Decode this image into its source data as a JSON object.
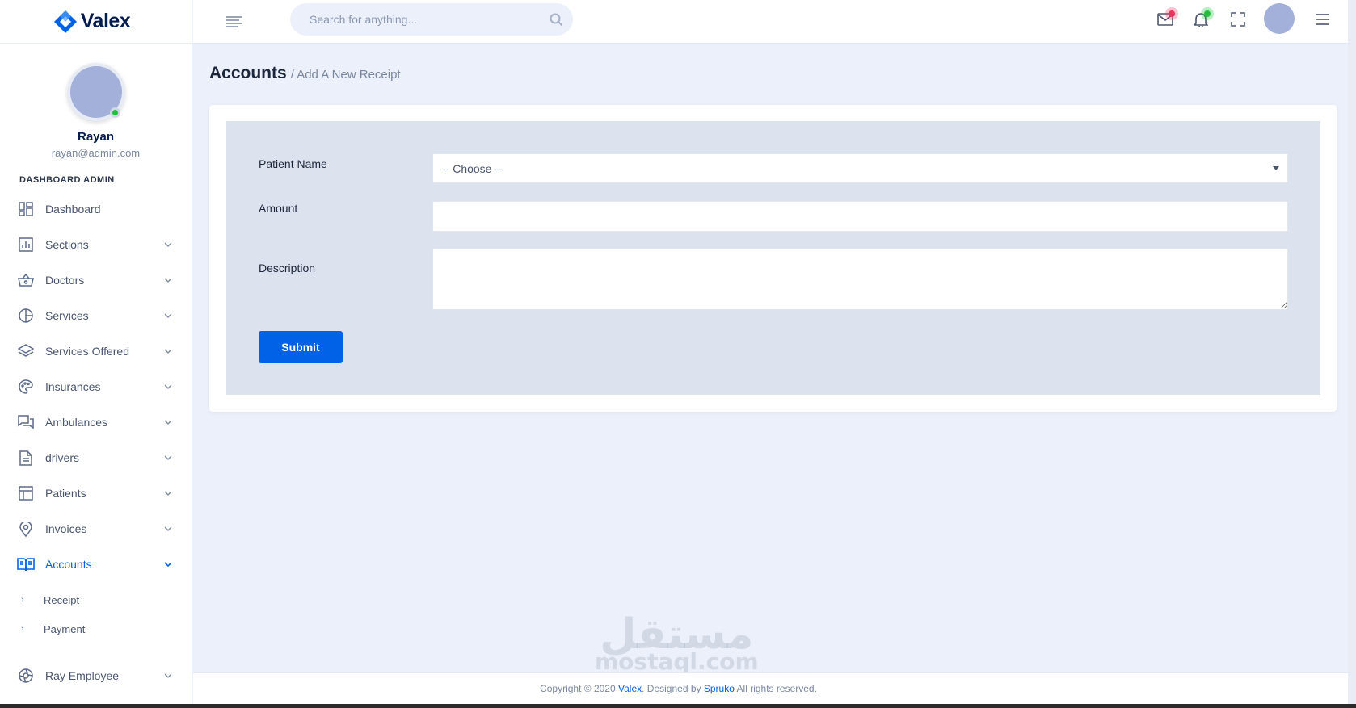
{
  "brand": {
    "name": "Valex",
    "primary_color": "#0162e8",
    "logo_icon": "diamond-logo-icon"
  },
  "sidebar": {
    "user": {
      "name": "Rayan",
      "email": "rayan@admin.com",
      "status": "online"
    },
    "category": "DASHBOARD ADMIN",
    "items": [
      {
        "label": "Dashboard",
        "icon": "dashboard-grid-icon",
        "expandable": false
      },
      {
        "label": "Sections",
        "icon": "bar-chart-icon",
        "expandable": true
      },
      {
        "label": "Doctors",
        "icon": "basket-icon",
        "expandable": true
      },
      {
        "label": "Services",
        "icon": "pie-chart-icon",
        "expandable": true
      },
      {
        "label": "Services Offered",
        "icon": "layers-icon",
        "expandable": true
      },
      {
        "label": "Insurances",
        "icon": "palette-icon",
        "expandable": true
      },
      {
        "label": "Ambulances",
        "icon": "chat-icon",
        "expandable": true
      },
      {
        "label": "drivers",
        "icon": "document-icon",
        "expandable": true
      },
      {
        "label": "Patients",
        "icon": "table-icon",
        "expandable": true
      },
      {
        "label": "Invoices",
        "icon": "map-pin-icon",
        "expandable": true
      },
      {
        "label": "Accounts",
        "icon": "open-book-icon",
        "expandable": true,
        "active": true
      }
    ],
    "accounts_submenu": [
      {
        "label": "Receipt"
      },
      {
        "label": "Payment"
      }
    ],
    "last_item": {
      "label": "Ray Employee",
      "icon": "aperture-icon",
      "expandable": true
    }
  },
  "header": {
    "search_placeholder": "Search for anything...",
    "icons": [
      "menu-lines-icon",
      "search-icon",
      "mail-icon",
      "bell-icon",
      "fullscreen-icon",
      "avatar",
      "hamburger-icon"
    ]
  },
  "page": {
    "title": "Accounts",
    "subtitle": "/ Add A New Receipt"
  },
  "form": {
    "patient_label": "Patient Name",
    "patient_selected": "-- Choose --",
    "amount_label": "Amount",
    "amount_value": "",
    "description_label": "Description",
    "description_value": "",
    "submit_label": "Submit"
  },
  "watermark": {
    "arabic": "مستقل",
    "latin": "mostaql.com"
  },
  "footer": {
    "prefix": "Copyright © 2020 ",
    "brand_link": "Valex",
    "middle": ". Designed by ",
    "designer_link": "Spruko",
    "suffix": " All rights reserved."
  }
}
